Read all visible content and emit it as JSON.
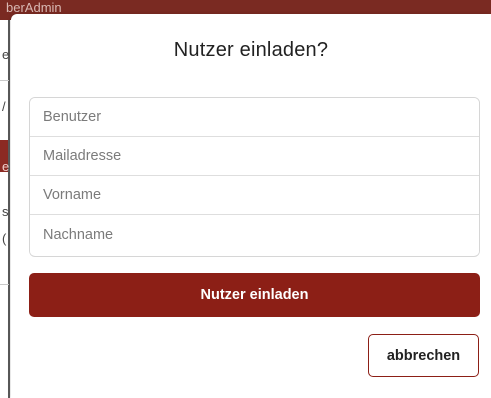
{
  "background": {
    "topbar_text": "berAdmin",
    "left_fragments": [
      "e",
      "/",
      "e",
      "s",
      "("
    ]
  },
  "modal": {
    "title": "Nutzer einladen?",
    "fields": [
      {
        "name": "benutzer",
        "placeholder": "Benutzer",
        "value": ""
      },
      {
        "name": "mailadresse",
        "placeholder": "Mailadresse",
        "value": ""
      },
      {
        "name": "vorname",
        "placeholder": "Vorname",
        "value": ""
      },
      {
        "name": "nachname",
        "placeholder": "Nachname",
        "value": ""
      }
    ],
    "primary_button": "Nutzer einladen",
    "cancel_button": "abbrechen"
  },
  "colors": {
    "accent": "#8c1f16",
    "topbar": "#7a2a22"
  }
}
